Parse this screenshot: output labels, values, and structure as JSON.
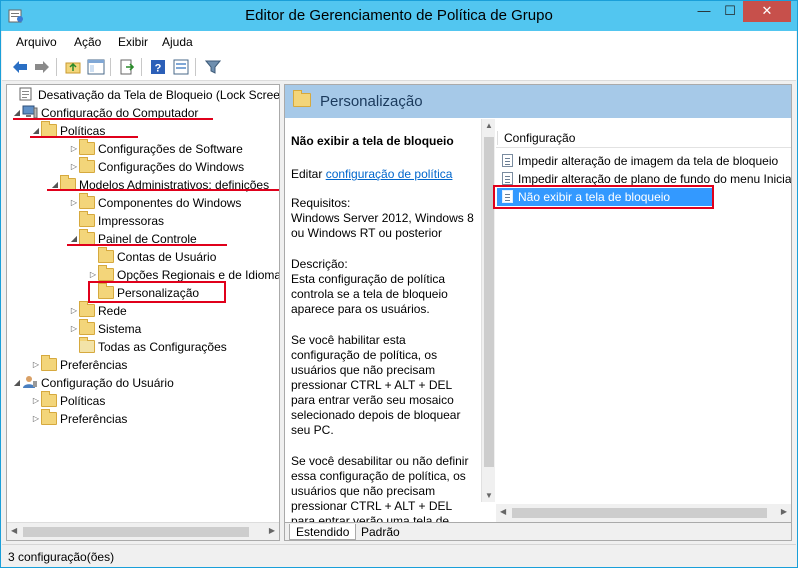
{
  "window": {
    "title": "Editor de Gerenciamento de Política de Grupo",
    "min_label": "—",
    "max_label": "☐",
    "close_label": "✕"
  },
  "menu": [
    "Arquivo",
    "Ação",
    "Exibir",
    "Ajuda"
  ],
  "tree": {
    "items": [
      {
        "label": "Desativação da Tela de Bloqueio (Lock Screen)",
        "icon": "policy-doc-icon",
        "expander": ""
      },
      {
        "label": "Configuração do Computador",
        "icon": "computer-icon",
        "expander": "◢"
      },
      {
        "label": "Políticas",
        "icon": "folder-icon",
        "expander": "◢"
      },
      {
        "label": "Configurações de Software",
        "icon": "folder-icon",
        "expander": "▷"
      },
      {
        "label": "Configurações do Windows",
        "icon": "folder-icon",
        "expander": "▷"
      },
      {
        "label": "Modelos Administrativos: definições",
        "icon": "folder-icon",
        "expander": "◢"
      },
      {
        "label": "Componentes do Windows",
        "icon": "folder-icon",
        "expander": "▷"
      },
      {
        "label": "Impressoras",
        "icon": "folder-icon",
        "expander": ""
      },
      {
        "label": "Painel de Controle",
        "icon": "folder-icon",
        "expander": "◢"
      },
      {
        "label": "Contas de Usuário",
        "icon": "folder-icon",
        "expander": ""
      },
      {
        "label": "Opções Regionais e de Idioma",
        "icon": "folder-icon",
        "expander": "▷"
      },
      {
        "label": "Personalização",
        "icon": "folder-open-icon",
        "expander": ""
      },
      {
        "label": "Rede",
        "icon": "folder-icon",
        "expander": "▷"
      },
      {
        "label": "Sistema",
        "icon": "folder-icon",
        "expander": "▷"
      },
      {
        "label": "Todas as Configurações",
        "icon": "settings-folder-icon",
        "expander": ""
      },
      {
        "label": "Preferências",
        "icon": "folder-icon",
        "expander": "▷"
      },
      {
        "label": "Configuração do Usuário",
        "icon": "user-icon",
        "expander": "◢"
      },
      {
        "label": "Políticas",
        "icon": "folder-icon",
        "expander": "▷"
      },
      {
        "label": "Preferências",
        "icon": "folder-icon",
        "expander": "▷"
      }
    ]
  },
  "right": {
    "header_title": "Personalização",
    "desc_title": "Não exibir a tela de bloqueio",
    "edit_prefix": "Editar ",
    "edit_link": "configuração de política",
    "requirements_label": "Requisitos:",
    "requirements_text": "Windows Server 2012, Windows 8 ou Windows RT ou posterior",
    "description_label": "Descrição:",
    "description_p1": "Esta configuração de política controla se a tela de bloqueio aparece para os usuários.",
    "description_p2": "Se você habilitar esta configuração de política, os usuários que não precisam pressionar CTRL + ALT + DEL para entrar verão seu mosaico selecionado depois de bloquear seu PC.",
    "description_p3": "Se você desabilitar ou não definir essa configuração de política, os usuários que não precisam pressionar CTRL + ALT + DEL para entrar verão uma tela de bloqueio",
    "list_header": "Configuração",
    "list_items": [
      "Impedir alteração de imagem da tela de bloqueio",
      "Impedir alteração de plano de fundo do menu Iniciar",
      "Não exibir a tela de bloqueio"
    ],
    "tabs": [
      "Estendido",
      "Padrão"
    ]
  },
  "status": "3 configuração(ões)",
  "colors": {
    "title_bar": "#52c6f0",
    "selection": "#3399ff",
    "highlight_red": "#e0001b",
    "header_band": "#a6c9e8"
  }
}
